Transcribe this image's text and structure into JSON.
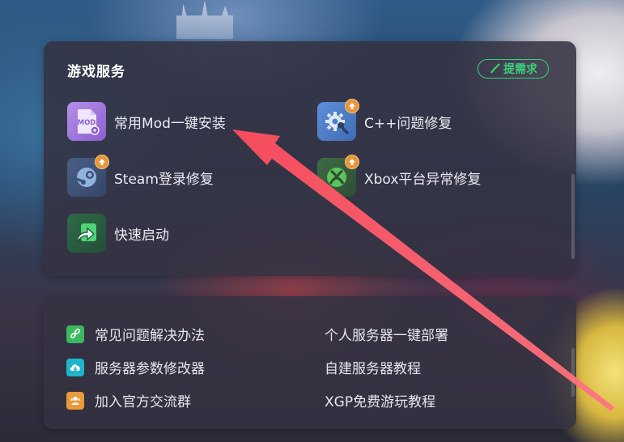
{
  "services_panel": {
    "title": "游戏服务",
    "request_button": "提需求",
    "items": [
      {
        "label": "常用Mod一键安装",
        "icon": "mod-icon",
        "icon_text": "MOD",
        "badge": false
      },
      {
        "label": "C++问题修复",
        "icon": "gear-repair-icon",
        "badge": true
      },
      {
        "label": "Steam登录修复",
        "icon": "steam-icon",
        "badge": true
      },
      {
        "label": "Xbox平台异常修复",
        "icon": "xbox-icon",
        "badge": true
      },
      {
        "label": "快速启动",
        "icon": "fast-launch-icon",
        "badge": false
      }
    ]
  },
  "links_panel": {
    "left": [
      {
        "label": "常见问题解决办法",
        "icon": "link-icon",
        "color": "#3bb75e"
      },
      {
        "label": "服务器参数修改器",
        "icon": "cloud-download-icon",
        "color": "#1fb6c9"
      },
      {
        "label": "加入官方交流群",
        "icon": "group-icon",
        "color": "#e99a3c"
      }
    ],
    "right": [
      {
        "label": "个人服务器一键部署"
      },
      {
        "label": "自建服务器教程"
      },
      {
        "label": "XGP免费游玩教程"
      }
    ]
  },
  "colors": {
    "accent_green": "#3ad07a",
    "annotation_arrow": "#ff4d5e",
    "badge_orange": "#e8953a"
  }
}
